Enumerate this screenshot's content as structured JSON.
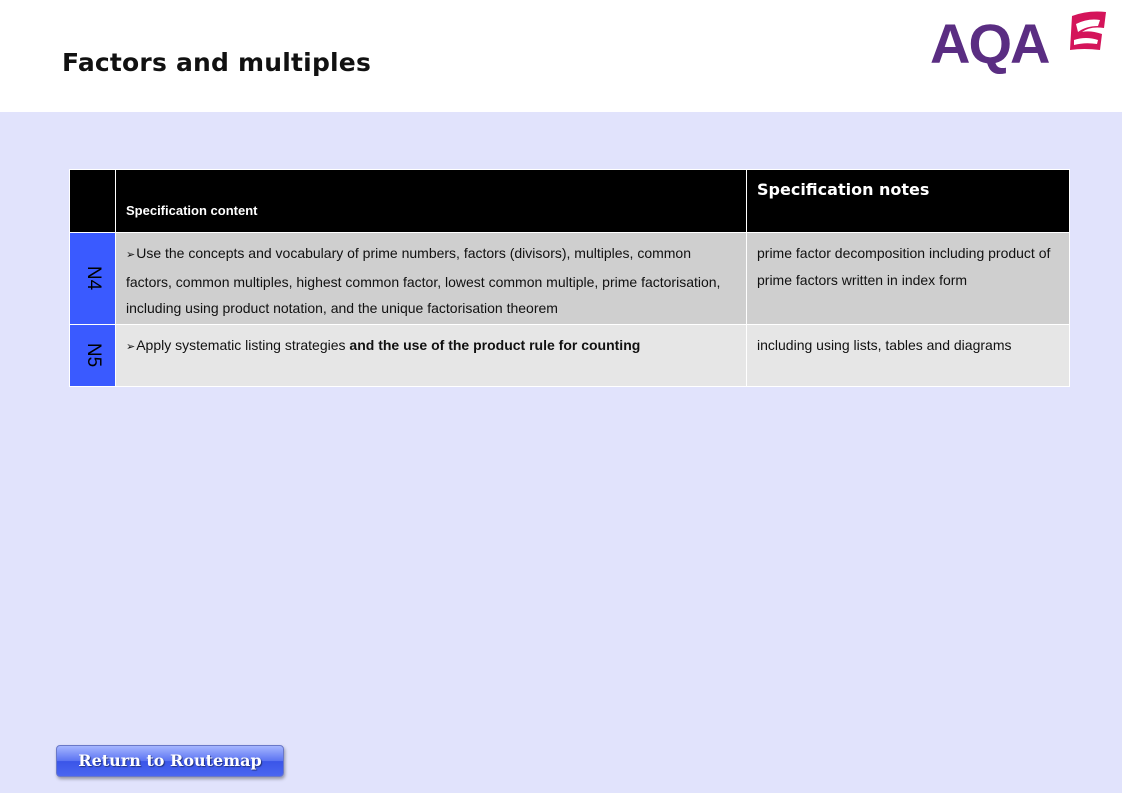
{
  "header": {
    "title": "Factors and multiples",
    "logo_text": "AQA"
  },
  "colors": {
    "logo_purple": "#5a2d82",
    "logo_mark": "#d4145a",
    "code_cell": "#3a5aff",
    "background": "#e1e3fc"
  },
  "table": {
    "headers": {
      "content": "Specification content",
      "notes": "Specification notes"
    },
    "rows": [
      {
        "code": "N4",
        "content_arrow": "➢",
        "content": "Use the concepts and vocabulary of prime numbers, factors (divisors), multiples, common factors, common multiples, highest common factor, lowest common multiple, prime factorisation, including using product notation, and the unique factorisation theorem",
        "content_bold": "",
        "notes": "prime factor decomposition including product of prime factors written in index form"
      },
      {
        "code": "N5",
        "content_arrow": "➢",
        "content": "Apply systematic listing strategies ",
        "content_bold": "and the use of the product rule for counting",
        "notes": "including using lists, tables and diagrams"
      }
    ]
  },
  "footer": {
    "return_label": "Return to Routemap"
  }
}
